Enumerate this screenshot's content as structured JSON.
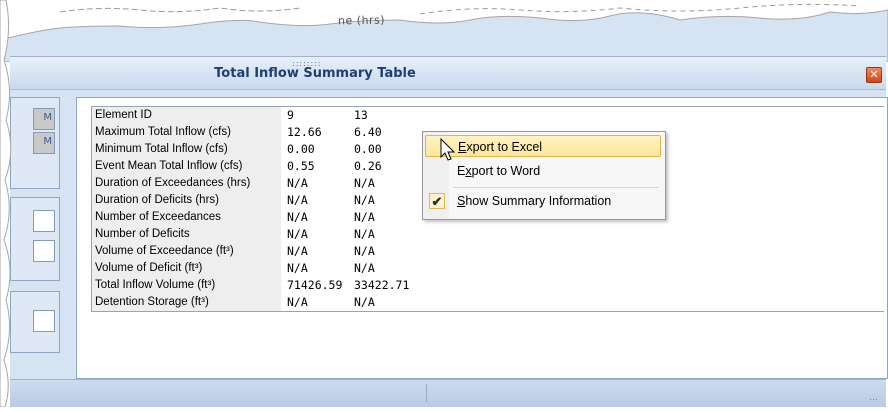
{
  "background": {
    "partial_text": "ne (hrs)"
  },
  "window": {
    "title": "Total Inflow Summary Table",
    "close_glyph": "✕",
    "grip_glyph": "::::::::",
    "resize_glyph": "…"
  },
  "left_panel": {
    "field_glyph_1": "M",
    "field_glyph_2": "M"
  },
  "table": {
    "rows": [
      {
        "label": "Element ID",
        "v1": "9",
        "v2": "13"
      },
      {
        "label": "Maximum Total Inflow (cfs)",
        "v1": "12.66",
        "v2": "6.40"
      },
      {
        "label": "Minimum Total Inflow (cfs)",
        "v1": "0.00",
        "v2": "0.00"
      },
      {
        "label": "Event Mean Total Inflow (cfs)",
        "v1": "0.55",
        "v2": "0.26"
      },
      {
        "label": "Duration of Exceedances (hrs)",
        "v1": "N/A",
        "v2": "N/A"
      },
      {
        "label": "Duration of Deficits (hrs)",
        "v1": "N/A",
        "v2": "N/A"
      },
      {
        "label": "Number of Exceedances",
        "v1": "N/A",
        "v2": "N/A"
      },
      {
        "label": "Number of Deficits",
        "v1": "N/A",
        "v2": "N/A"
      },
      {
        "label": "Volume of Exceedance (ft³)",
        "v1": "N/A",
        "v2": "N/A"
      },
      {
        "label": "Volume of Deficit (ft³)",
        "v1": "N/A",
        "v2": "N/A"
      },
      {
        "label": "Total Inflow Volume (ft³)",
        "v1": "71426.59",
        "v2": "33422.71"
      },
      {
        "label": "Detention Storage (ft³)",
        "v1": "N/A",
        "v2": "N/A"
      }
    ]
  },
  "context_menu": {
    "items": [
      {
        "label": "Export to Excel",
        "accel_index": 0,
        "highlighted": true
      },
      {
        "label": "Export to Word",
        "accel_index": 1,
        "highlighted": false
      },
      {
        "label": "Show Summary Information",
        "accel_index": 0,
        "checked": true
      }
    ],
    "check_glyph": "✔"
  },
  "colors": {
    "title_text": "#1e3f74",
    "menu_highlight": "#fde79a",
    "close_button": "#d3461c"
  }
}
